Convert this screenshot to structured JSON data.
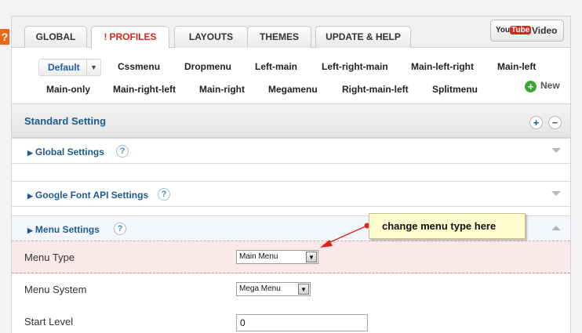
{
  "help_flag": "?",
  "tabs": [
    {
      "label": "GLOBAL"
    },
    {
      "label": "PROFILES",
      "prefix": "!"
    },
    {
      "label": "LAYOUTS"
    },
    {
      "label": "THEMES"
    },
    {
      "label": "UPDATE & HELP"
    }
  ],
  "video_button": {
    "logo_you": "You",
    "logo_tube": "Tube",
    "label": "Video"
  },
  "profiles": {
    "default": "Default",
    "row1": [
      "Cssmenu",
      "Dropmenu",
      "Left-main",
      "Left-right-main",
      "Main-left-right",
      "Main-left"
    ],
    "row2": [
      "Main-only",
      "Main-right-left",
      "Main-right",
      "Megamenu",
      "Right-main-left",
      "Splitmenu"
    ],
    "new_label": "New"
  },
  "standard_setting": {
    "title": "Standard Setting",
    "expand": "+",
    "collapse": "−"
  },
  "sections": [
    {
      "label": "Global Settings"
    },
    {
      "label": "Google Font API Settings"
    },
    {
      "label": "Menu Settings"
    }
  ],
  "help_glyph": "?",
  "fields": {
    "menu_type": {
      "label": "Menu Type",
      "value": "Main Menu"
    },
    "menu_system": {
      "label": "Menu System",
      "value": "Mega Menu"
    },
    "start_level": {
      "label": "Start Level",
      "value": "0"
    }
  },
  "callout": {
    "text": "change menu type here"
  },
  "colors": {
    "accent_blue": "#1f5a8f",
    "active_tab_red": "#d9261c",
    "callout_bg": "#fffccf",
    "highlight_row": "#fbe9ea"
  }
}
